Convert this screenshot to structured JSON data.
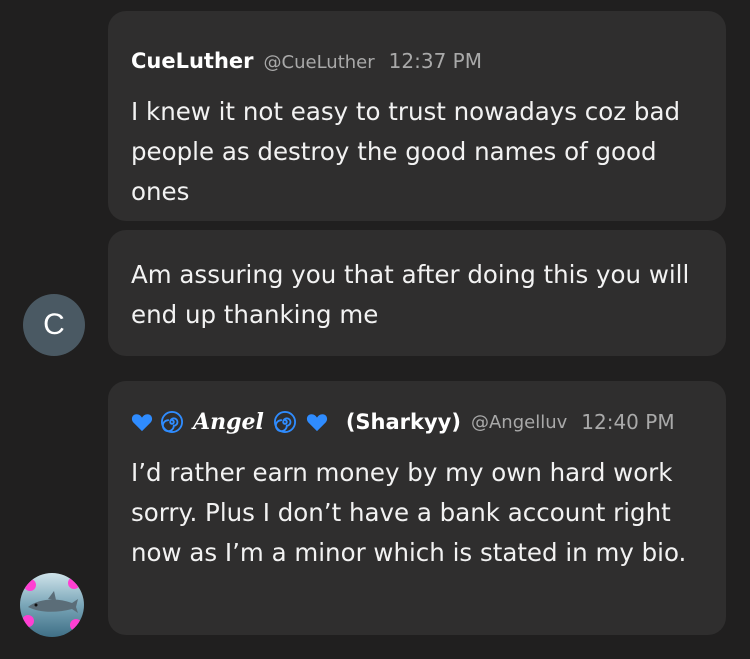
{
  "messages": [
    {
      "display_name": "CueLuther",
      "handle": "@CueLuther",
      "time": "12:37 PM",
      "text": "I knew it not easy to trust nowadays coz bad people as destroy the good names of good ones"
    },
    {
      "text": "Am assuring you that after doing this you will end up thanking me",
      "avatar_initial": "C"
    },
    {
      "display_name_fancy": "Angel",
      "display_name_suffix": "(Sharkyy)",
      "handle": "@Angelluv",
      "time": "12:40 PM",
      "text": "I’d rather earn money by my own hard work sorry. Plus I don’t have a bank account right now as I’m a minor which is stated in my bio."
    }
  ],
  "colors": {
    "background": "#201f1f",
    "bubble": "#2f2e2e",
    "muted_text": "#a9a9a9",
    "avatar_c": "#4a5963",
    "heart_blue": "#2f8cff",
    "spiral_blue": "#2f8cff",
    "pink_accent": "#ff3fd2"
  },
  "icons": [
    "blue-heart-icon",
    "cyclone-icon",
    "user-avatar-icon"
  ]
}
